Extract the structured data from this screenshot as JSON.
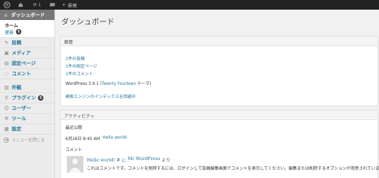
{
  "adminbar": {
    "updates_count": "1",
    "new_label": "新規"
  },
  "sidebar": {
    "dashboard_label": "ダッシュボード",
    "submenu": [
      {
        "label": "ホーム"
      },
      {
        "label": "更新",
        "badge": "1"
      }
    ],
    "items": [
      {
        "label": "投稿",
        "icon": "pin-icon"
      },
      {
        "label": "メディア",
        "icon": "media-icon"
      },
      {
        "label": "固定ページ",
        "icon": "pages-icon"
      },
      {
        "label": "コメント",
        "icon": "comments-icon"
      },
      {
        "label": "外観",
        "icon": "appearance-icon"
      },
      {
        "label": "プラグイン",
        "icon": "plugins-icon",
        "badge": "1"
      },
      {
        "label": "ユーザー",
        "icon": "users-icon"
      },
      {
        "label": "ツール",
        "icon": "tools-icon"
      },
      {
        "label": "設定",
        "icon": "settings-icon"
      }
    ],
    "collapse_label": "メニューを閉じる"
  },
  "main": {
    "title": "ダッシュボード",
    "glance": {
      "header": "概要",
      "links": [
        "1件の投稿",
        "1件の固定ページ",
        "1件のコメント"
      ],
      "version_prefix": "WordPress 3.9.1 (",
      "theme_name": "Twenty Fourteen",
      "version_suffix": " テーマ)",
      "search_notice": "検索エンジンのインデックスを回避中"
    },
    "activity": {
      "header": "アクティビティ",
      "recent_heading": "最近公開",
      "recent_date": "6月26日 8:45 AM",
      "recent_post": "Hello world!",
      "comments_heading": "コメント",
      "comment_post": "Hello world! # に",
      "comment_author": "Mr WordPress",
      "comment_suffix": "より",
      "comment_text": "これはコメントです。コメントを削除するには、ログインして投稿編集画面でコメントを表示してください。編集または削除するオプションが用意されています。"
    }
  },
  "colors": {
    "adminbar_bg": "#222222",
    "link": "#21759b",
    "active_menu_bg": "#777777"
  }
}
